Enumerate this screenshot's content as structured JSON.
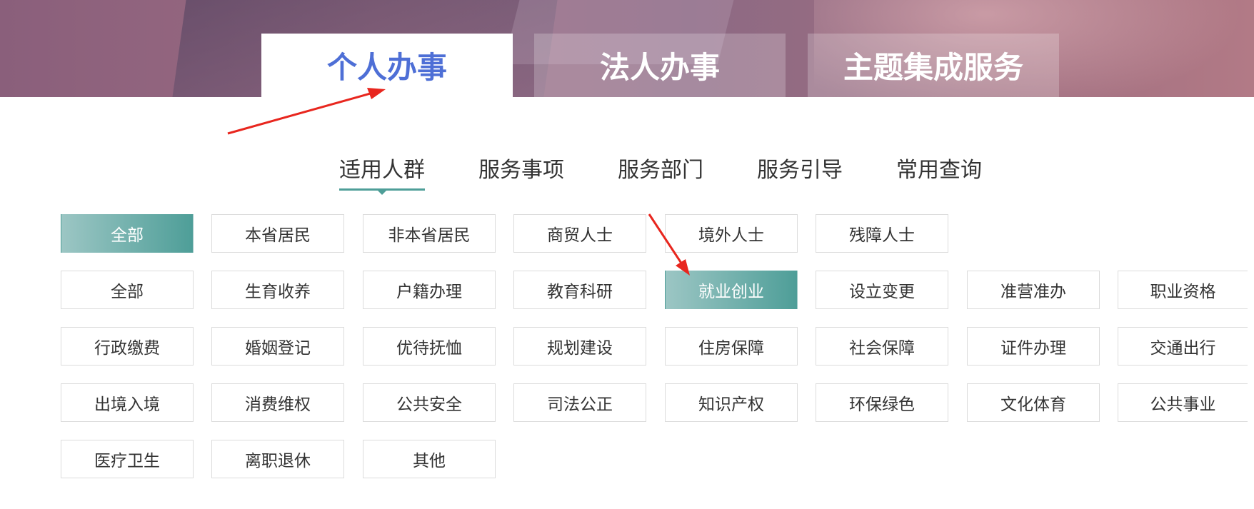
{
  "top_tabs": [
    "个人办事",
    "法人办事",
    "主题集成服务"
  ],
  "sub_tabs": [
    "适用人群",
    "服务事项",
    "服务部门",
    "服务引导",
    "常用查询"
  ],
  "groups": [
    "全部",
    "本省居民",
    "非本省居民",
    "商贸人士",
    "境外人士",
    "残障人士"
  ],
  "topics": [
    "全部",
    "生育收养",
    "户籍办理",
    "教育科研",
    "就业创业",
    "设立变更",
    "准营准办",
    "职业资格",
    "行政缴费",
    "婚姻登记",
    "优待抚恤",
    "规划建设",
    "住房保障",
    "社会保障",
    "证件办理",
    "交通出行",
    "出境入境",
    "消费维权",
    "公共安全",
    "司法公正",
    "知识产权",
    "环保绿色",
    "文化体育",
    "公共事业",
    "医疗卫生",
    "离职退休",
    "其他"
  ],
  "colors": {
    "accent": "#4e9e98",
    "active_tab_text": "#4e6fd6",
    "annotation_arrow": "#e8261e"
  }
}
